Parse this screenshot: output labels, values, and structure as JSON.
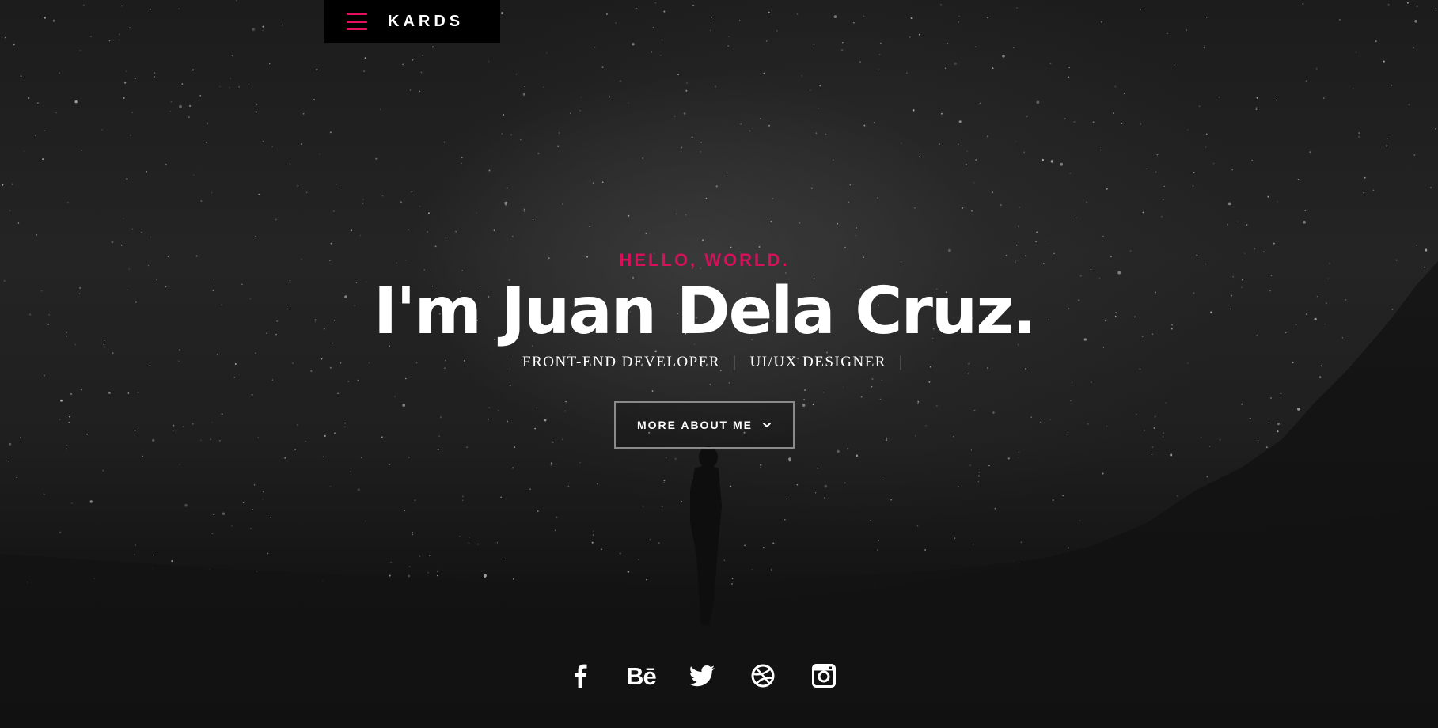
{
  "nav": {
    "menu_icon": "hamburger-menu-icon",
    "brand": "KARDS",
    "accent_color": "#e0115f"
  },
  "hero": {
    "greeting": "HELLO, WORLD.",
    "name": "I'm Juan Dela Cruz.",
    "roles": [
      "FRONT-END DEVELOPER",
      "UI/UX DESIGNER"
    ],
    "cta_label": "MORE ABOUT ME",
    "cta_icon": "chevron-down-icon"
  },
  "social": {
    "items": [
      {
        "name": "facebook",
        "icon": "facebook-icon"
      },
      {
        "name": "behance",
        "icon": "behance-icon",
        "glyph": "Bē"
      },
      {
        "name": "twitter",
        "icon": "twitter-icon"
      },
      {
        "name": "dribbble",
        "icon": "dribbble-icon"
      },
      {
        "name": "instagram",
        "icon": "instagram-icon"
      }
    ]
  }
}
